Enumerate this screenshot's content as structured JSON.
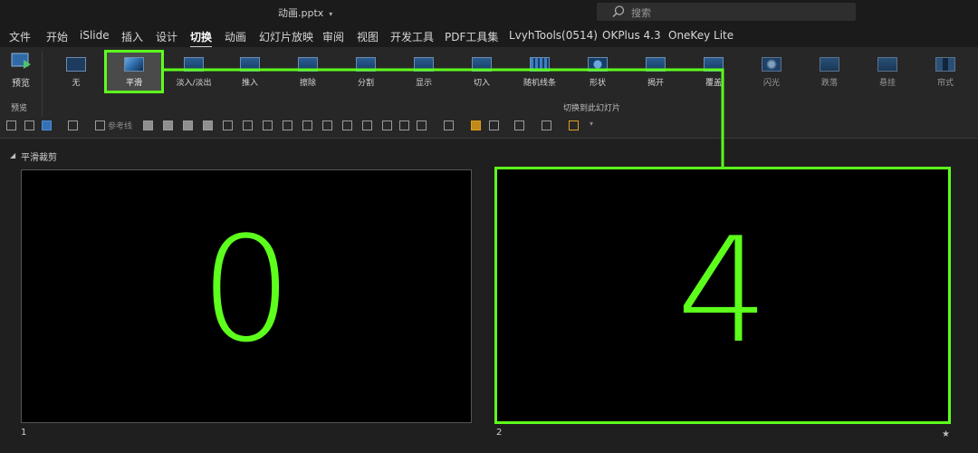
{
  "window": {
    "title": "动画.pptx",
    "caret": "▾"
  },
  "search": {
    "placeholder": "搜索"
  },
  "menu": {
    "tabs": [
      {
        "label": "文件",
        "active": false
      },
      {
        "label": "开始",
        "active": false
      },
      {
        "label": "iSlide",
        "active": false
      },
      {
        "label": "插入",
        "active": false
      },
      {
        "label": "设计",
        "active": false
      },
      {
        "label": "切换",
        "active": true
      },
      {
        "label": "动画",
        "active": false
      },
      {
        "label": "幻灯片放映",
        "active": false
      },
      {
        "label": "审阅",
        "active": false
      },
      {
        "label": "视图",
        "active": false
      },
      {
        "label": "开发工具",
        "active": false
      },
      {
        "label": "PDF工具集",
        "active": false
      },
      {
        "label": "LvyhTools(0514)",
        "active": false
      },
      {
        "label": "OKPlus 4.3",
        "active": false
      },
      {
        "label": "OneKey Lite",
        "active": false
      }
    ]
  },
  "ribbon": {
    "preview": {
      "label": "预览",
      "group_label": "预览"
    },
    "transitions_group_label": "切换到此幻灯片",
    "transitions": [
      {
        "label": "无",
        "icon": "none-transition-icon"
      },
      {
        "label": "平滑",
        "icon": "morph-transition-icon",
        "selected": true
      },
      {
        "label": "淡入/淡出",
        "icon": "fade-transition-icon"
      },
      {
        "label": "推入",
        "icon": "push-transition-icon"
      },
      {
        "label": "擦除",
        "icon": "wipe-transition-icon"
      },
      {
        "label": "分割",
        "icon": "split-transition-icon"
      },
      {
        "label": "显示",
        "icon": "reveal-transition-icon"
      },
      {
        "label": "切入",
        "icon": "cut-transition-icon"
      },
      {
        "label": "随机线条",
        "icon": "random-bars-transition-icon"
      },
      {
        "label": "形状",
        "icon": "shape-transition-icon"
      },
      {
        "label": "揭开",
        "icon": "uncover-transition-icon"
      },
      {
        "label": "覆盖",
        "icon": "cover-transition-icon"
      },
      {
        "label": "闪光",
        "icon": "flash-transition-icon"
      },
      {
        "label": "跌落",
        "icon": "fall-over-transition-icon"
      },
      {
        "label": "悬挂",
        "icon": "drape-transition-icon"
      },
      {
        "label": "帘式",
        "icon": "curtains-transition-icon"
      }
    ],
    "toolrow": {
      "guides_label": "参考线"
    }
  },
  "section": {
    "title": "平滑裁剪",
    "caret": "◢"
  },
  "slides": [
    {
      "number": "1",
      "content": "0"
    },
    {
      "number": "2",
      "content": "4",
      "marker": "★"
    }
  ],
  "colors": {
    "highlight": "#5dff1c",
    "background": "#1f1f1f",
    "ribbon": "#272727"
  }
}
